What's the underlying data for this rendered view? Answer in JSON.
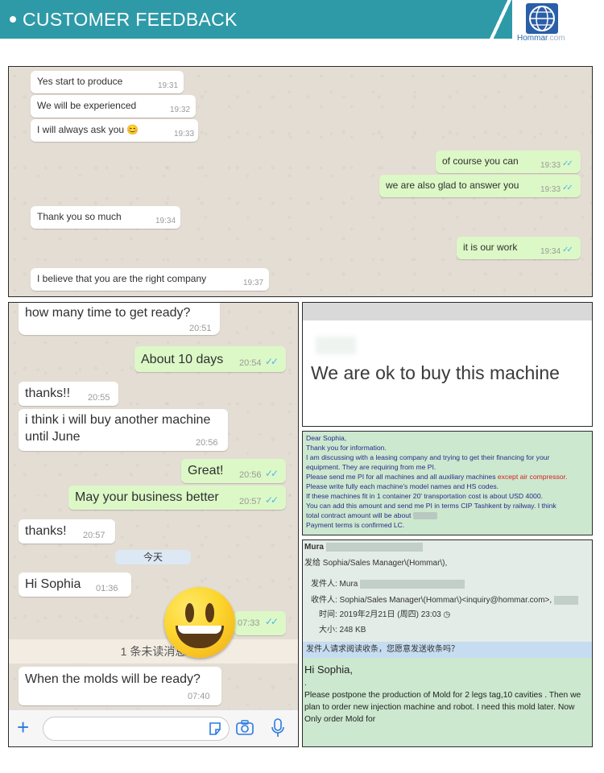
{
  "header": {
    "title": "CUSTOMER FEEDBACK",
    "brand": "Hommar",
    "brand_suffix": ".com",
    "accent": "#2e9aa8"
  },
  "chat1": {
    "messages": [
      {
        "dir": "in",
        "text": "Yes start to produce",
        "time": "19:31"
      },
      {
        "dir": "in",
        "text": "We will be experienced",
        "time": "19:32"
      },
      {
        "dir": "in",
        "text": "I will always ask you",
        "emoji": "😊",
        "time": "19:33"
      },
      {
        "dir": "out",
        "text": "of course you can",
        "time": "19:33"
      },
      {
        "dir": "out",
        "text": "we are also glad to answer you",
        "time": "19:33"
      },
      {
        "dir": "in",
        "text": "Thank you so much",
        "time": "19:34"
      },
      {
        "dir": "out",
        "text": "it is our work",
        "time": "19:34"
      },
      {
        "dir": "in",
        "text": "I believe that you are the right company",
        "time": "19:37"
      }
    ]
  },
  "chat2": {
    "messages": [
      {
        "dir": "in",
        "text": "how many time to get ready?",
        "time": "20:51"
      },
      {
        "dir": "out",
        "text": "About 10 days",
        "time": "20:54"
      },
      {
        "dir": "in",
        "text": "thanks!!",
        "time": "20:55"
      },
      {
        "dir": "in",
        "text": "i think i will buy another machine",
        "text2": "until June",
        "time": "20:56"
      },
      {
        "dir": "out",
        "text": "Great!",
        "time": "20:56"
      },
      {
        "dir": "out",
        "text": "May your business better",
        "time": "20:57"
      },
      {
        "dir": "in",
        "text": "thanks!",
        "time": "20:57"
      },
      {
        "dir": "in",
        "text": "Hi Sophia",
        "time": "01:36"
      },
      {
        "dir": "out",
        "text": "",
        "time": "07:33"
      },
      {
        "dir": "in",
        "text": "When the molds will be ready?",
        "time": "07:40"
      }
    ],
    "day_label": "今天",
    "unread_label": "1 条未读消息"
  },
  "snippet": {
    "text": "We are ok to buy this machine"
  },
  "email1": {
    "lines": [
      "Dear Sophia,",
      "Thank you for information.",
      "I am discussing with a leasing company and trying to get their financing for your",
      "equipment. They are requiring from me PI.",
      "Please send me PI for all machines and all auxiliary machines",
      "Please write fully each machine's model names and HS codes.",
      "If these machines fit in 1 container 20' transportation cost is about USD 4000.",
      "You can add this amount and send me PI in terms CIP Tashkent by railway. I think",
      "total contract amount will be about",
      "Payment terms is confirmed LC."
    ],
    "red_text": "except air compressor."
  },
  "email2": {
    "sender_short": "Mura",
    "to_line": "发给 Sophia/Sales Manager\\(Hommar\\),",
    "from_label": "发件人: Mura",
    "to_label": "收件人: Sophia/Sales Manager\\(Hommar\\)<inquiry@hommar.com>,",
    "time_label": "时间: 2019年2月21日 (周四) 23:03",
    "size_label": "大小: 248 KB",
    "receipt_notice": "发件人请求阅读收条，您愿意发送收条吗？",
    "greeting": "Hi Sophia,",
    "dot": ".",
    "body": [
      "Please postpone the production of Mold for 2 legs tag,10 cavities . Then we",
      "plan to order new injection machine and robot. I need this mold later. Now",
      "Only order Mold for"
    ]
  }
}
